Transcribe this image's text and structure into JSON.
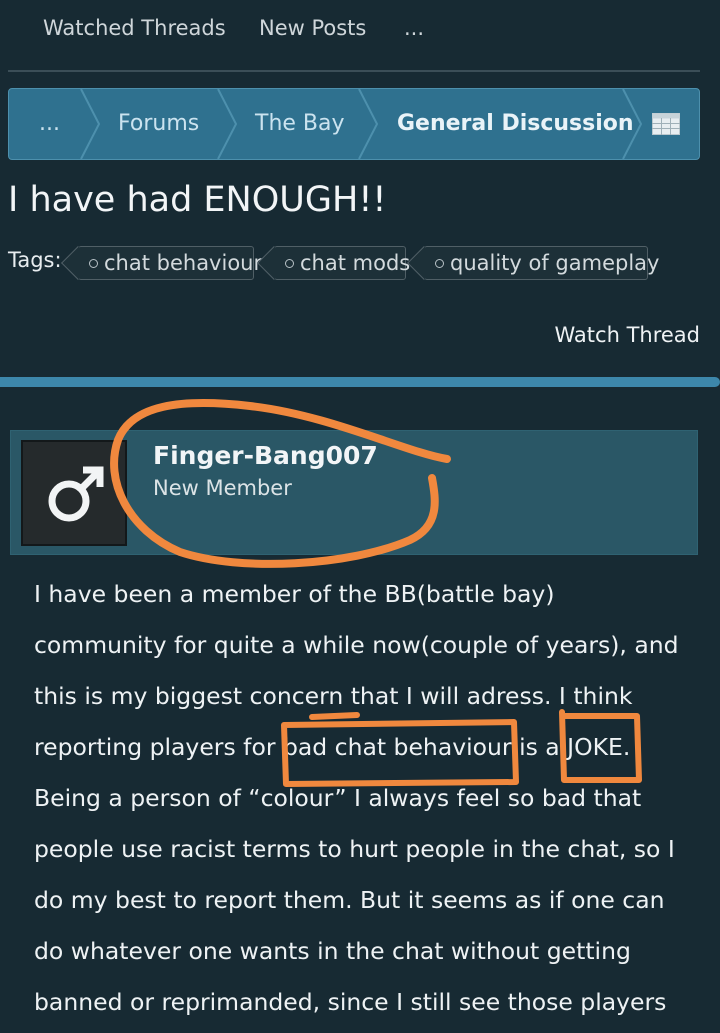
{
  "topnav": {
    "items": [
      "Watched Threads",
      "New Posts",
      "..."
    ]
  },
  "breadcrumb": {
    "items": [
      "...",
      "Forums",
      "The Bay",
      "General Discussion"
    ],
    "icon": "table-icon"
  },
  "thread": {
    "title": "I have had ENOUGH!!",
    "tags_label": "Tags:",
    "tags": [
      "chat behaviour",
      "chat mods",
      "quality of gameplay"
    ],
    "watch_label": "Watch Thread"
  },
  "post": {
    "author": "Finger-Bang007",
    "role": "New Member",
    "avatar_icon": "male-symbol-icon",
    "lines": [
      "I have been a member of the BB(battle bay)",
      "community for quite a while now(couple of years), and",
      "this is my biggest concern that I will adress. I think",
      "reporting players for bad chat behaviour is a JOKE.",
      "Being a person of “colour” I always feel so bad that",
      "people use racist terms to hurt people in the chat, so I",
      "do my best to report them. But it seems as if one can",
      "do whatever one wants in the chat without getting",
      "banned or reprimanded, since I still see those players"
    ]
  },
  "colors": {
    "background": "#172a33",
    "breadcrumb": "#2f718f",
    "userbox": "#2a5766",
    "annotation": "#f0883e"
  }
}
